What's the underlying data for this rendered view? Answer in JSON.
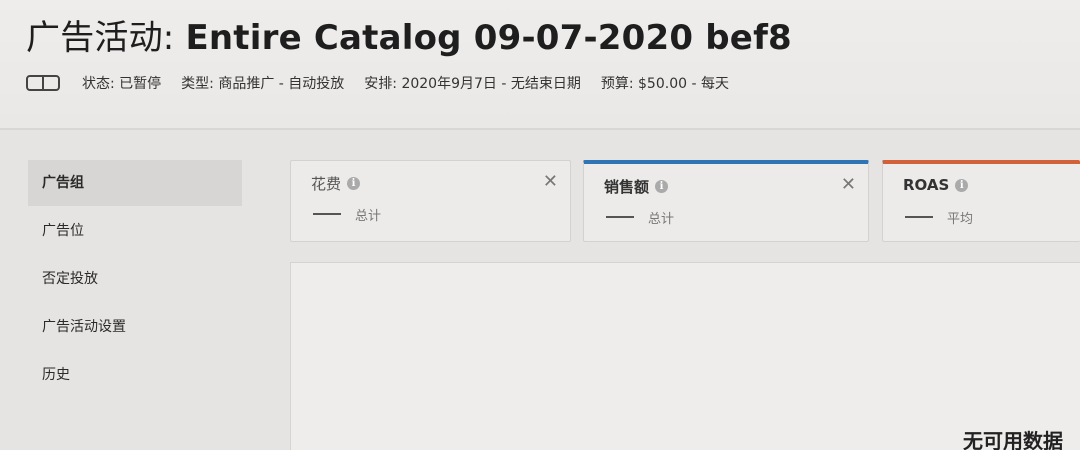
{
  "header": {
    "title_prefix": "广告活动: ",
    "campaign_name": "Entire Catalog 09-07-2020 bef8",
    "meta": {
      "status": "状态: 已暂停",
      "type": "类型: 商品推广 - 自动投放",
      "schedule": "安排: 2020年9月7日 - 无结束日期",
      "budget": "预算: $50.00 - 每天"
    },
    "toggle_icon": "toggle-icon"
  },
  "sidebar": {
    "items": [
      {
        "label": "广告组",
        "active": true
      },
      {
        "label": "广告位",
        "active": false
      },
      {
        "label": "否定投放",
        "active": false
      },
      {
        "label": "广告活动设置",
        "active": false
      },
      {
        "label": "历史",
        "active": false
      }
    ]
  },
  "metrics": [
    {
      "name": "花费",
      "aggregate": "总计",
      "value": "—",
      "accent": null,
      "closable": true
    },
    {
      "name": "销售额",
      "aggregate": "总计",
      "value": "—",
      "accent": "#2f74b5",
      "closable": true
    },
    {
      "name": "ROAS",
      "aggregate": "平均",
      "value": "—",
      "accent": "#d2613a",
      "closable": false
    }
  ],
  "chart": {
    "empty_message": "无可用数据"
  },
  "icons": {
    "info": "info-icon",
    "close": "close-icon"
  },
  "colors": {
    "accent_blue": "#2f74b5",
    "accent_orange": "#d2613a"
  }
}
